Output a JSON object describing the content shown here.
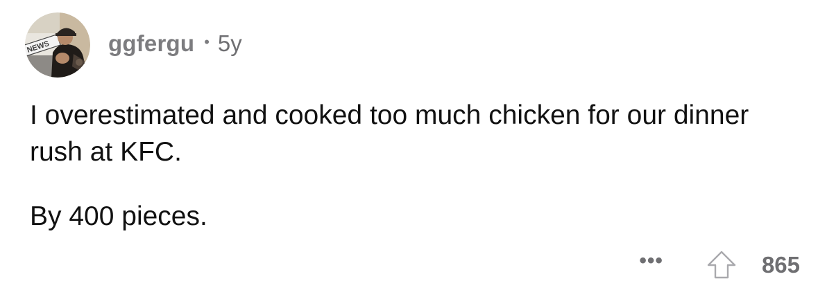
{
  "comment": {
    "author": "ggfergu",
    "separator": "•",
    "age": "5y",
    "avatar_logo_text": "NEWS",
    "body": [
      "I overestimated and cooked too much chicken for our dinner rush at KFC.",
      "By 400 pieces."
    ],
    "actions": {
      "more_label": "•••",
      "upvote_icon": "upvote-arrow-icon",
      "score": "865"
    }
  }
}
